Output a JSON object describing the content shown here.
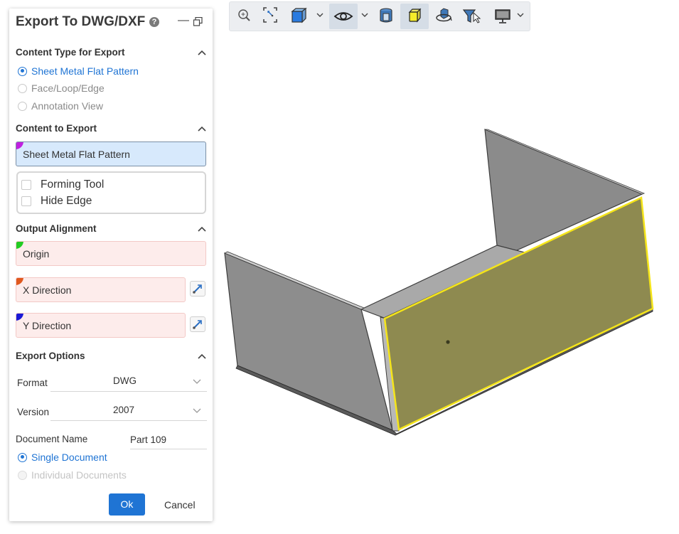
{
  "panel": {
    "title": "Export To DWG/DXF",
    "help_glyph": "?",
    "minimize_glyph": "—",
    "content_type": {
      "heading": "Content Type for Export",
      "options": [
        {
          "label": "Sheet Metal Flat Pattern",
          "selected": true
        },
        {
          "label": "Face/Loop/Edge",
          "selected": false
        },
        {
          "label": "Annotation View",
          "selected": false
        }
      ]
    },
    "content_to_export": {
      "heading": "Content to Export",
      "selection": "Sheet Metal Flat Pattern",
      "selection_marker_color": "#c020e0",
      "checkboxes": [
        {
          "label": "Forming Tool",
          "checked": false
        },
        {
          "label": "Hide Edge",
          "checked": false
        }
      ]
    },
    "output_alignment": {
      "heading": "Output Alignment",
      "origin": {
        "label": "Origin",
        "marker_color": "#22cc22"
      },
      "x_direction": {
        "label": "X Direction",
        "marker_color": "#e0581e"
      },
      "y_direction": {
        "label": "Y Direction",
        "marker_color": "#1a1ad6"
      }
    },
    "export_options": {
      "heading": "Export Options",
      "format_label": "Format",
      "format_value": "DWG",
      "version_label": "Version",
      "version_value": "2007",
      "document_name_label": "Document Name",
      "document_name_value": "Part 109",
      "document_mode": [
        {
          "label": "Single Document",
          "selected": true
        },
        {
          "label": "Individual Documents",
          "selected": false,
          "disabled": true
        }
      ]
    },
    "ok_label": "Ok",
    "cancel_label": "Cancel"
  },
  "toolbar": {
    "buttons": [
      {
        "icon": "zoom-icon"
      },
      {
        "icon": "zoom-to-fit-icon"
      },
      {
        "icon": "view-cube-icon",
        "dropdown": true
      },
      {
        "icon": "visibility-eye-icon",
        "dropdown": true,
        "active": true
      },
      {
        "icon": "section-view-icon"
      },
      {
        "icon": "shaded-display-icon",
        "active": true
      },
      {
        "icon": "rotate-view-icon"
      },
      {
        "icon": "selection-filter-icon"
      },
      {
        "icon": "display-monitor-icon",
        "dropdown": true
      }
    ]
  },
  "colors": {
    "accent": "#1f74d4",
    "model_face": "#8c8c8c",
    "selected_face": "#8e8a50",
    "selection_outline": "#f5e51a"
  }
}
